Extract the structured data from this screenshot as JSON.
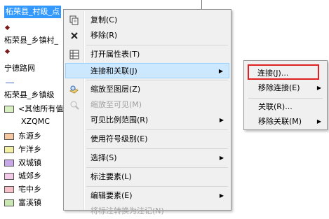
{
  "tree": {
    "layer1": "柘荣县_村级_点",
    "layer2": "柘荣县_乡镇村_",
    "layer3": "宁德路网",
    "layer4": "柘荣县_乡镇级",
    "other_values": "<其他所有值",
    "field_name": "XZQMC",
    "classes": [
      {
        "label": "东源乡",
        "color": "#f5c6a0"
      },
      {
        "label": "乍洋乡",
        "color": "#f3f0a6"
      },
      {
        "label": "双城镇",
        "color": "#c8a8e8"
      },
      {
        "label": "城郊乡",
        "color": "#f3c9e8"
      },
      {
        "label": "宅中乡",
        "color": "#f6c0c8"
      },
      {
        "label": "富溪镇",
        "color": "#c8e8b0"
      }
    ]
  },
  "menu": {
    "copy": "复制(C)",
    "remove": "移除(R)",
    "open_attr": "打开属性表(T)",
    "joins_relates": "连接和关联(J)",
    "zoom_layer": "缩放至图层(Z)",
    "zoom_visible": "缩放至可见(M)",
    "visible_scale": "可见比例范围(R)",
    "use_symbol_levels": "使用符号级别(E)",
    "selection": "选择(S)",
    "label_features": "标注要素(L)",
    "edit_features": "编辑要素(E)",
    "convert_labels": "将标注转换为注记(N)"
  },
  "submenu": {
    "join": "连接(J)...",
    "remove_join": "移除连接(E)",
    "relate": "关联(R)...",
    "remove_relate": "移除关联(M)"
  }
}
